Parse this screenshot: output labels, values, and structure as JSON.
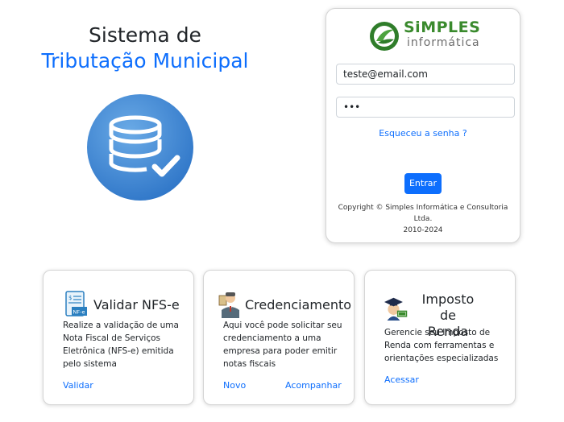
{
  "hero": {
    "title_line1": "Sistema de",
    "title_line2": "Tributação Municipal"
  },
  "icons": {
    "hero_icon": "database-check-icon",
    "nfse_icon": "invoice-nfe-icon",
    "credenciamento_icon": "official-person-icon",
    "imposto_icon": "graduate-money-icon"
  },
  "colors": {
    "accent": "#0d6efd",
    "logo_green": "#3a8a2d",
    "hero_blue": "#3f86d6"
  },
  "login": {
    "logo_main": "SiMPLES",
    "logo_sub": "informática",
    "email_value": "teste@email.com",
    "password_value": "•••",
    "forgot_label": "Esqueceu a senha ?",
    "submit_label": "Entrar",
    "copyright_line1": "Copyright © Simples Informática e Consultoria Ltda.",
    "copyright_line2": "2010-2024"
  },
  "cards": [
    {
      "title": "Validar NFS-e",
      "text": "Realize a validação de uma Nota Fiscal de Serviços Eletrônica (NFS-e) emitida pelo sistema",
      "links": [
        "Validar"
      ]
    },
    {
      "title": "Credenciamento",
      "text": "Aqui você pode solicitar seu credenciamento a uma empresa para poder emitir notas fiscais",
      "links": [
        "Novo",
        "Acompanhar"
      ]
    },
    {
      "title_line1": "Imposto de",
      "title_line2": "Renda",
      "text": "Gerencie seu Imposto de Renda com ferramentas e orientações especializadas",
      "links": [
        "Acessar"
      ]
    }
  ]
}
